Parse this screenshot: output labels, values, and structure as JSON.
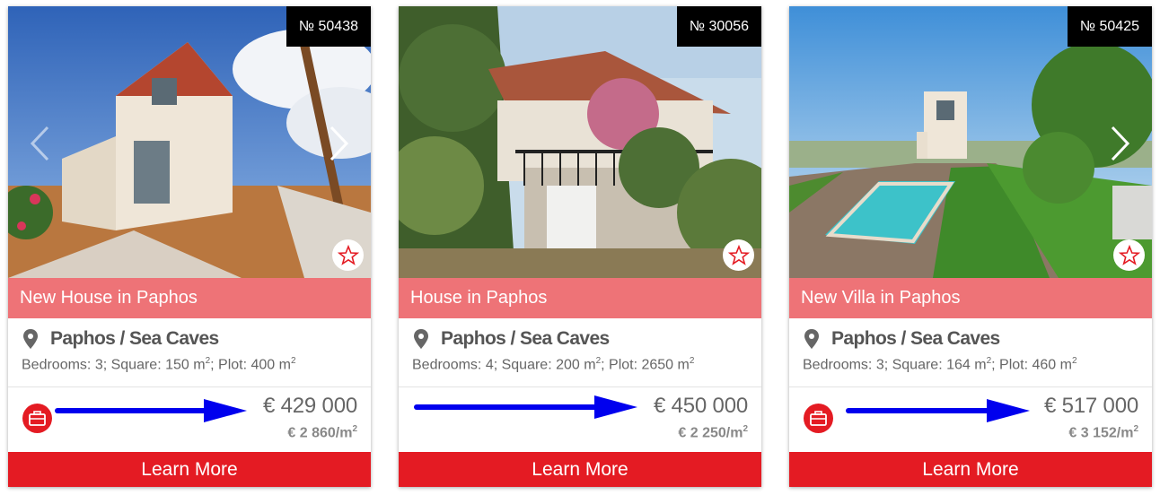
{
  "colors": {
    "title_bar": "#ee7377",
    "button": "#e41b23",
    "badge": "#000000",
    "arrow": "#0000ee",
    "accent_red": "#e41b23"
  },
  "cards": [
    {
      "ref": "№ 50438",
      "title": "New House in Paphos",
      "location": "Paphos / Sea Caves",
      "specs": {
        "bedrooms_prefix": "Bedrooms: 3; Square: 150 m",
        "plot_prefix": "; Plot: 400 m",
        "exp": "2"
      },
      "price": "€ 429 000",
      "price_per_sqm": "€ 2 860/m",
      "sqm_exp": "2",
      "button": "Learn More",
      "has_case_icon": true,
      "has_prev_arrow": true,
      "has_next_arrow": true,
      "icons": [
        "chevron-left-icon",
        "chevron-right-icon",
        "star-icon",
        "map-pin-icon",
        "briefcase-icon"
      ]
    },
    {
      "ref": "№ 30056",
      "title": "House in Paphos",
      "location": "Paphos / Sea Caves",
      "specs": {
        "bedrooms_prefix": "Bedrooms: 4; Square: 200 m",
        "plot_prefix": "; Plot: 2650 m",
        "exp": "2"
      },
      "price": "€ 450 000",
      "price_per_sqm": "€ 2 250/m",
      "sqm_exp": "2",
      "button": "Learn More",
      "has_case_icon": false,
      "has_prev_arrow": false,
      "has_next_arrow": false,
      "icons": [
        "star-icon",
        "map-pin-icon"
      ]
    },
    {
      "ref": "№ 50425",
      "title": "New Villa in Paphos",
      "location": "Paphos / Sea Caves",
      "specs": {
        "bedrooms_prefix": "Bedrooms: 3; Square: 164 m",
        "plot_prefix": "; Plot: 460 m",
        "exp": "2"
      },
      "price": "€ 517 000",
      "price_per_sqm": "€ 3 152/m",
      "sqm_exp": "2",
      "button": "Learn More",
      "has_case_icon": true,
      "has_prev_arrow": false,
      "has_next_arrow": true,
      "icons": [
        "chevron-right-icon",
        "star-icon",
        "map-pin-icon",
        "briefcase-icon"
      ]
    }
  ]
}
